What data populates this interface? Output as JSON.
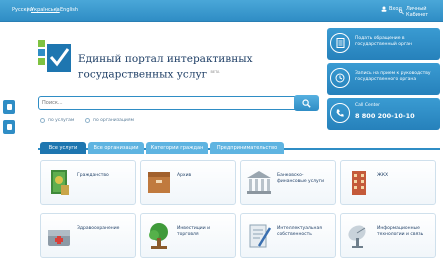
{
  "topbar": {
    "languages": [
      "Русский",
      "Українська",
      "English"
    ],
    "right_items": [
      "Вход",
      "Личный Кабинет"
    ]
  },
  "portal": {
    "title": "Единый портал интерактивных государственных услуг",
    "badge": "BETA"
  },
  "search": {
    "placeholder": "Поиск...",
    "options": [
      "по услугам",
      "по организациям"
    ]
  },
  "right_panel": {
    "items": [
      {
        "text": "Подать обращение в государственный орган"
      },
      {
        "text": "Запись на прием к руководству государственного органа"
      }
    ],
    "call_center": {
      "label": "Call Center",
      "number": "8 800 200-10-10"
    }
  },
  "tabs": [
    "Все услуги",
    "Все организации",
    "Категории граждан",
    "Предпринимательство"
  ],
  "categories": [
    {
      "label": "Гражданство"
    },
    {
      "label": "Архив"
    },
    {
      "label": "Банковско-финансовые услуги"
    },
    {
      "label": "ЖКХ"
    },
    {
      "label": "Здравоохранение"
    },
    {
      "label": "Инвестиции и торговля"
    },
    {
      "label": "Интеллектуальная собственность"
    },
    {
      "label": "Информационные технологии и связь"
    }
  ],
  "colors": {
    "accent": "#2f8dc5",
    "title": "#1f3f66",
    "card_border": "#cfe0ec"
  }
}
